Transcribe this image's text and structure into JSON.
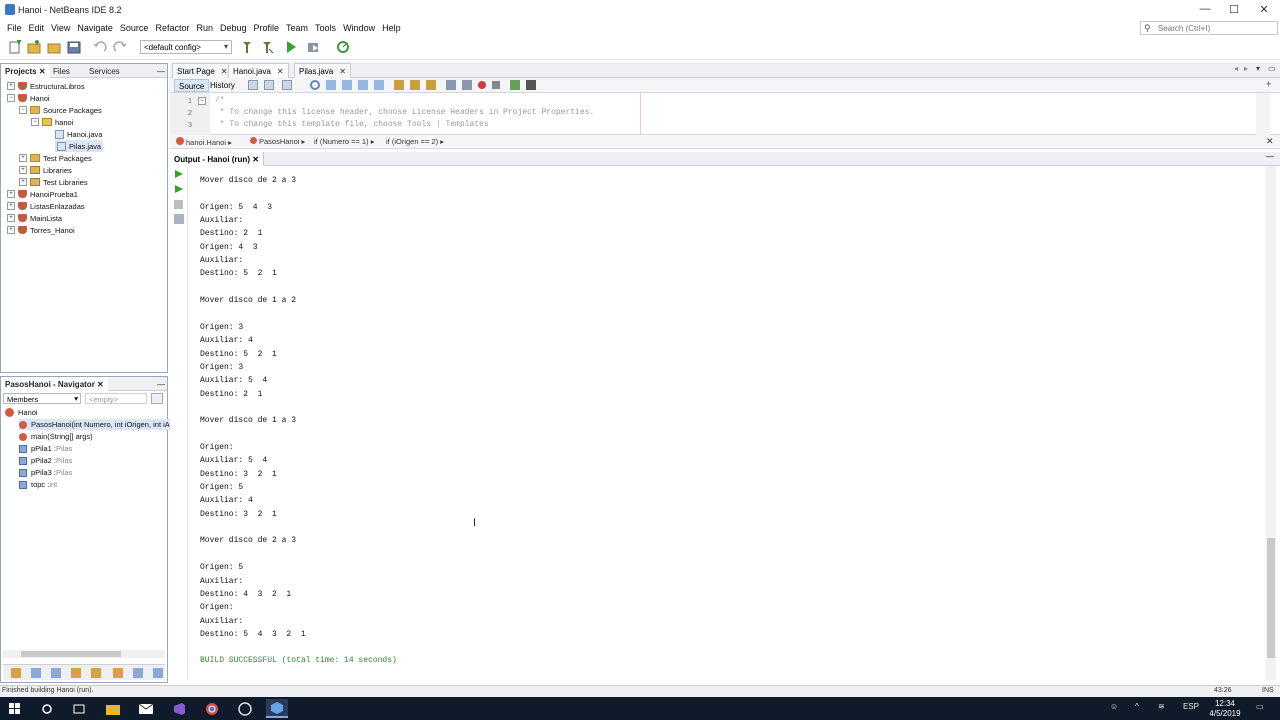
{
  "window": {
    "title": "Hanoi - NetBeans IDE 8.2",
    "controls": [
      "—",
      "☐",
      "✕"
    ]
  },
  "menu": [
    "File",
    "Edit",
    "View",
    "Navigate",
    "Source",
    "Refactor",
    "Run",
    "Debug",
    "Profile",
    "Team",
    "Tools",
    "Window",
    "Help"
  ],
  "search": {
    "placeholder": "Search (Ctrl+I)"
  },
  "toolbar": {
    "config": "<default config>"
  },
  "projects_panel": {
    "tabs": [
      "Projects",
      "Files",
      "Services"
    ],
    "tree": [
      {
        "label": "EstructuraLibros",
        "icon": "project-icon",
        "toggle": "+"
      },
      {
        "label": "Hanoi",
        "icon": "project-icon",
        "toggle": "−"
      },
      {
        "label": "Source Packages",
        "icon": "folder-icon",
        "toggle": "−"
      },
      {
        "label": "hanoi",
        "icon": "package-icon",
        "toggle": "−"
      },
      {
        "label": "Hanoi.java",
        "icon": "java-file-icon",
        "toggle": ""
      },
      {
        "label": "Pilas.java",
        "icon": "java-file-icon",
        "toggle": "",
        "selected": true
      },
      {
        "label": "Test Packages",
        "icon": "folder-icon",
        "toggle": "+"
      },
      {
        "label": "Libraries",
        "icon": "library-icon",
        "toggle": "+"
      },
      {
        "label": "Test Libraries",
        "icon": "library-icon",
        "toggle": "+"
      },
      {
        "label": "HanoiPrueba1",
        "icon": "project-icon",
        "toggle": "+"
      },
      {
        "label": "ListasEnlazadas",
        "icon": "project-icon",
        "toggle": "+"
      },
      {
        "label": "MainLista",
        "icon": "project-icon",
        "toggle": "+"
      },
      {
        "label": "Torres_Hanoi",
        "icon": "project-icon",
        "toggle": "+"
      }
    ]
  },
  "navigator": {
    "title": "PasosHanoi - Navigator",
    "filter": "Members",
    "empty": "<empty>",
    "items": [
      {
        "label": "Hanoi",
        "type": "",
        "icon": "class-icon"
      },
      {
        "label": "PasosHanoi(int Numero, int iOrigen, int iAu",
        "type": "",
        "icon": "method-icon",
        "selected": true
      },
      {
        "label": "main(String[] args)",
        "type": "",
        "icon": "method-icon"
      },
      {
        "label": "pPila1 : ",
        "type": "Pilas",
        "icon": "field-icon"
      },
      {
        "label": "pPila2 : ",
        "type": "Pilas",
        "icon": "field-icon"
      },
      {
        "label": "pPila3 : ",
        "type": "Pilas",
        "icon": "field-icon"
      },
      {
        "label": "topc : ",
        "type": "int",
        "icon": "field-icon"
      }
    ]
  },
  "editor": {
    "tabs": [
      {
        "label": "Start Page",
        "active": false
      },
      {
        "label": "Hanoi.java",
        "active": true
      },
      {
        "label": "Pilas.java",
        "active": false
      }
    ],
    "view_tabs": [
      "Source",
      "History"
    ],
    "lines": [
      {
        "num": "1",
        "text": "/*"
      },
      {
        "num": "2",
        "text": " * To change this license header, choose License Headers in Project Properties."
      },
      {
        "num": "3",
        "text": " * To change this template file, choose Tools | Templates"
      }
    ],
    "breadcrumbs": [
      "hanoi.Hanoi",
      "PasosHanoi",
      "if (Numero == 1)",
      "if (iOrigen == 2)"
    ]
  },
  "output": {
    "title": "Output - Hanoi (run)",
    "lines": [
      "Mover disco de 2 a 3",
      "",
      "Origen: 5  4  3",
      "Auxiliar:",
      "Destino: 2  1",
      "Origen: 4  3",
      "Auxiliar:",
      "Destino: 5  2  1",
      "",
      "Mover disco de 1 a 2",
      "",
      "Origen: 3",
      "Auxiliar: 4",
      "Destino: 5  2  1",
      "Origen: 3",
      "Auxiliar: 5  4",
      "Destino: 2  1",
      "",
      "Mover disco de 1 a 3",
      "",
      "Origen:",
      "Auxiliar: 5  4",
      "Destino: 3  2  1",
      "Origen: 5",
      "Auxiliar: 4",
      "Destino: 3  2  1",
      "",
      "Mover disco de 2 a 3",
      "",
      "Origen: 5",
      "Auxiliar:",
      "Destino: 4  3  2  1",
      "Origen:",
      "Auxiliar:",
      "Destino: 5  4  3  2  1",
      ""
    ],
    "success": "BUILD SUCCESSFUL (total time: 14 seconds)"
  },
  "status": {
    "left": "Finished building Hanoi (run).",
    "right": "43:26",
    "mode": "INS"
  },
  "taskbar": {
    "lang": "ESP",
    "time": "12:34",
    "date": "4/5/2019"
  },
  "colors": {
    "success": "#2c8a2c",
    "taskbar": "#0f1a2a",
    "accent": "#3b78c4"
  }
}
